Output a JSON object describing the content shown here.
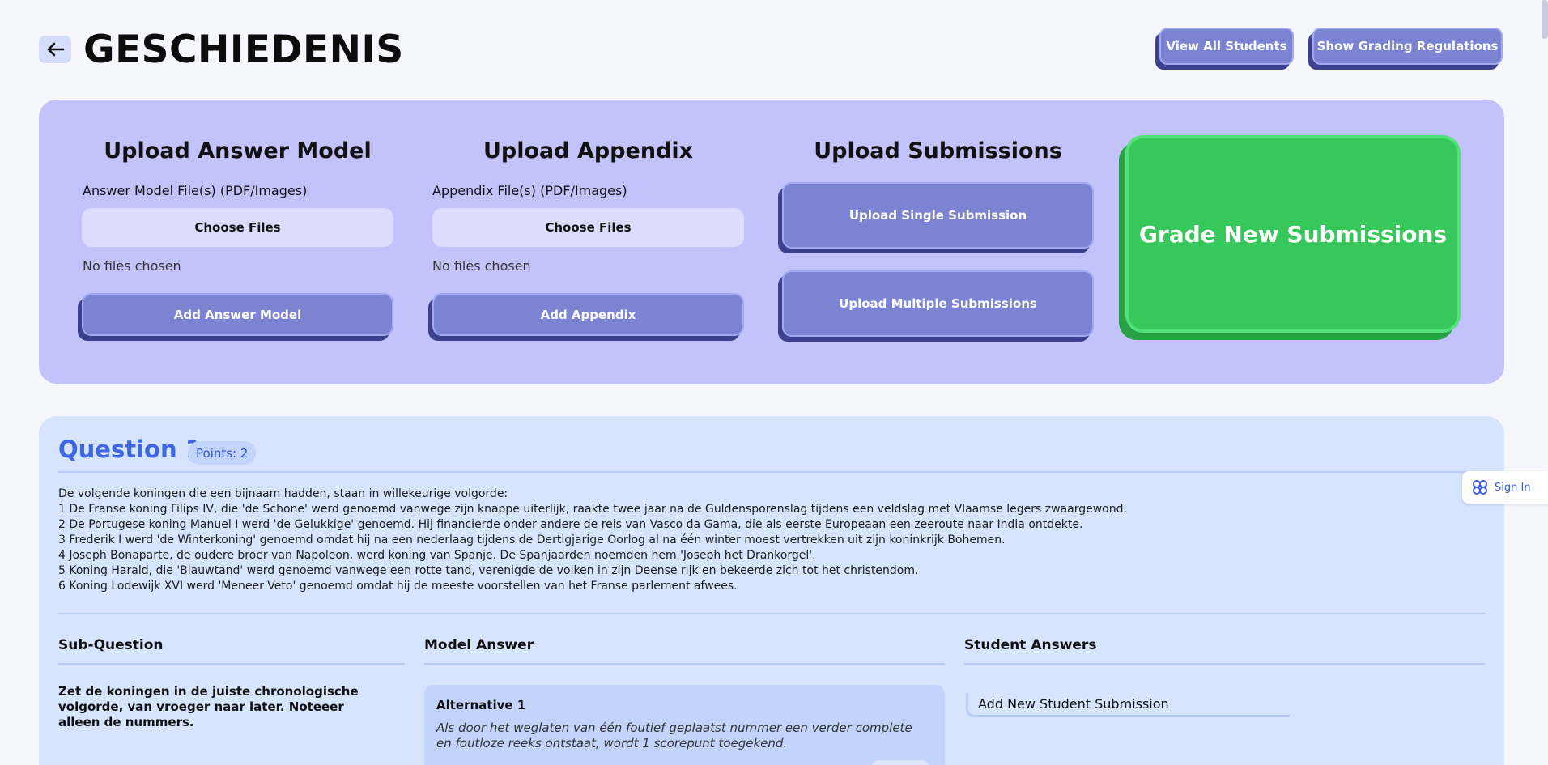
{
  "header": {
    "title": "GESCHIEDENIS",
    "view_all_students": "View All Students",
    "show_grading_regulations": "Show Grading Regulations"
  },
  "upload": {
    "answer_model": {
      "title": "Upload Answer Model",
      "field_label": "Answer Model File(s) (PDF/Images)",
      "choose_label": "Choose Files",
      "status": "No files chosen",
      "add_label": "Add Answer Model"
    },
    "appendix": {
      "title": "Upload Appendix",
      "field_label": "Appendix File(s) (PDF/Images)",
      "choose_label": "Choose Files",
      "status": "No files chosen",
      "add_label": "Add Appendix"
    },
    "submissions": {
      "title": "Upload Submissions",
      "single_label": "Upload Single Submission",
      "multiple_label": "Upload Multiple Submissions"
    },
    "grade_label": "Grade New Submissions"
  },
  "question": {
    "title": "Question 1",
    "points": "Points: 2",
    "text_lines": [
      "De volgende koningen die een bijnaam hadden, staan in willekeurige volgorde:",
      "1 De Franse koning Filips IV, die 'de Schone' werd genoemd vanwege zijn knappe uiterlijk, raakte twee jaar na de Guldensporenslag tijdens een veldslag met Vlaamse legers zwaargewond.",
      "2 De Portugese koning Manuel I werd 'de Gelukkige' genoemd. Hij financierde onder andere de reis van Vasco da Gama, die als eerste Europeaan een zeeroute naar India ontdekte.",
      "3 Frederik I werd 'de Winterkoning' genoemd omdat hij na een nederlaag tijdens de Dertigjarige Oorlog al na één winter moest vertrekken uit zijn koninkrijk Bohemen.",
      "4 Joseph Bonaparte, de oudere broer van Napoleon, werd koning van Spanje. De Spanjaarden noemden hem 'Joseph het Drankorgel'.",
      "5 Koning Harald, die 'Blauwtand' werd genoemd vanwege een rotte tand, verenigde de volken in zijn Deense rijk en bekeerde zich tot het christendom.",
      "6 Koning Lodewijk XVI werd 'Meneer Veto' genoemd omdat hij de meeste voorstellen van het Franse parlement afwees."
    ],
    "columns": {
      "sub_question": "Sub-Question",
      "model_answer": "Model Answer",
      "student_answers": "Student Answers"
    },
    "sub_question_text": "Zet de koningen in de juiste chronologische volgorde, van vroeger naar later. Noteeer alleen de nummers.",
    "alternative": {
      "title": "Alternative 1",
      "text": "Als door het weglaten van één foutief geplaatst nummer een verder complete en foutloze reeks ontstaat, wordt 1 scorepunt toegekend."
    },
    "add_student_submission": "Add New Student Submission"
  },
  "signin": {
    "label": "Sign In"
  },
  "colors": {
    "upload_panel": "#c3c3fb",
    "button_purple": "#7b83d2",
    "grade_green": "#37c85c",
    "question_blue": "#3d66e0"
  },
  "icons": {
    "back": "arrow-left-icon",
    "signin": "clover-icon"
  }
}
